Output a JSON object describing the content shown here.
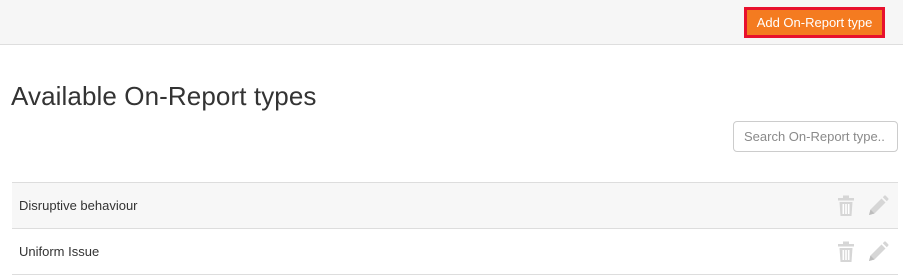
{
  "toolbar": {
    "add_button_label": "Add On-Report type"
  },
  "page": {
    "title": "Available On-Report types"
  },
  "search": {
    "placeholder": "Search On-Report type..",
    "value": ""
  },
  "types": {
    "rows": [
      {
        "name": "Disruptive behaviour",
        "delete_icon": "trash-icon",
        "edit_icon": "pencil-icon"
      },
      {
        "name": "Uniform Issue",
        "delete_icon": "trash-icon",
        "edit_icon": "pencil-icon"
      }
    ]
  },
  "colors": {
    "accent": "#f47b20",
    "highlight_border": "#e8112d",
    "icon_muted": "#d6d6d6"
  }
}
